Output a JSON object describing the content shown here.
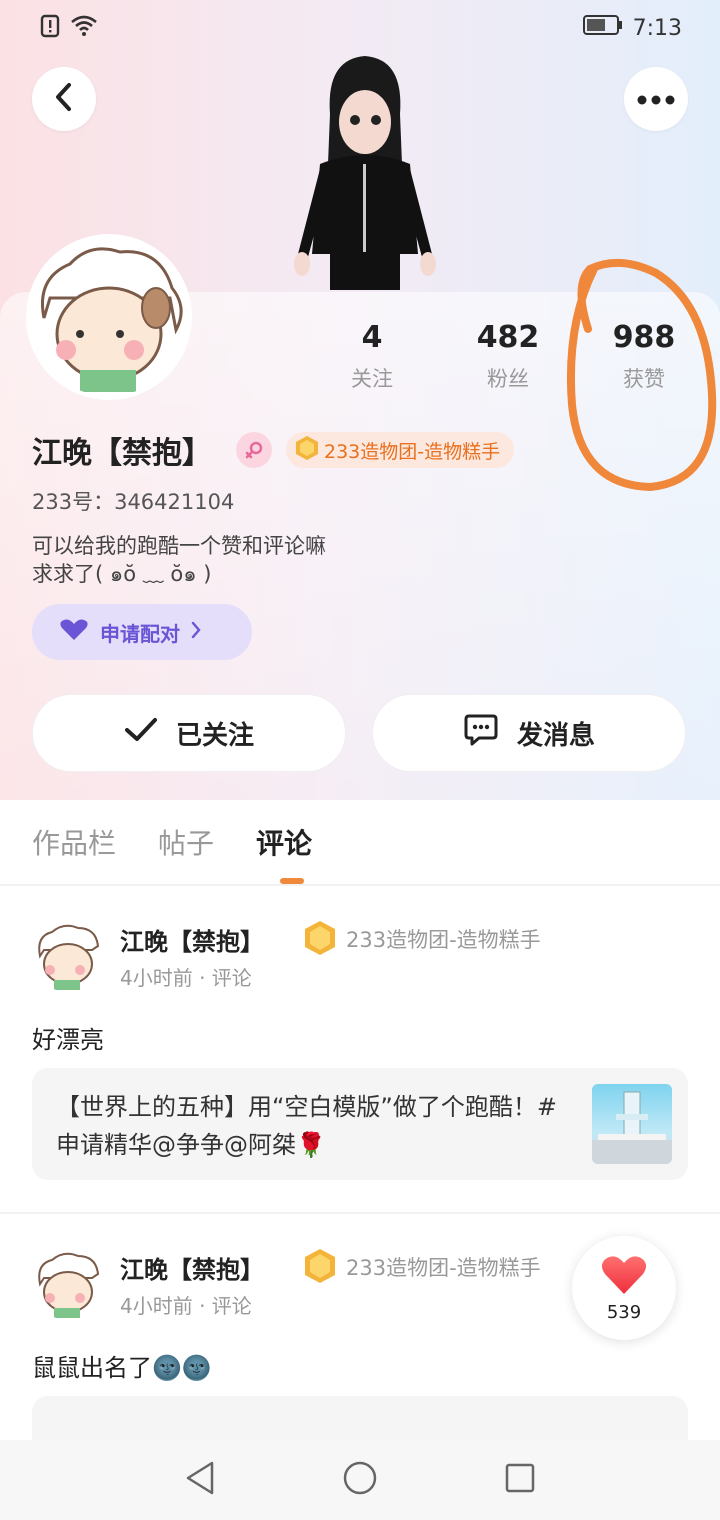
{
  "status_bar": {
    "time": "7:13",
    "icons": [
      "alert-icon",
      "wifi-icon",
      "battery-icon"
    ]
  },
  "header": {
    "back_icon": "chevron-left-icon",
    "more_icon": "more-horizontal-icon"
  },
  "profile": {
    "stats": [
      {
        "num": "4",
        "label": "关注"
      },
      {
        "num": "482",
        "label": "粉丝"
      },
      {
        "num": "988",
        "label": "获赞"
      }
    ],
    "name": "江晚【禁抱】",
    "badge": "233造物团-造物糕手",
    "uid": "233号：346421104",
    "bio_line1": "可以给我的跑酷一个赞和评论嘛",
    "bio_line2": "求求了( ๑ŏ ﹏ ŏ๑ )",
    "pair_label": "申请配对",
    "follow_label": "已关注",
    "message_label": "发消息"
  },
  "tabs": [
    {
      "label": "作品栏"
    },
    {
      "label": "帖子"
    },
    {
      "label": "评论"
    }
  ],
  "active_tab": "评论",
  "comments": [
    {
      "name": "江晚【禁抱】",
      "badge": "233造物团-造物糕手",
      "meta": "4小时前 · 评论",
      "text": "好漂亮",
      "post_title": "【世界上的五种】用“空白模版”做了个跑酷！#申请精华@争争@阿桀🌹"
    },
    {
      "name": "江晚【禁抱】",
      "badge": "233造物团-造物糕手",
      "meta": "4小时前 · 评论",
      "text": "鼠鼠出名了🌚🌚"
    }
  ],
  "like_fab": {
    "count": "539"
  },
  "colors": {
    "accent": "#f08a3a",
    "pair": "#6a55d6",
    "badge": "#e8701e",
    "annotation": "#f0883c"
  }
}
